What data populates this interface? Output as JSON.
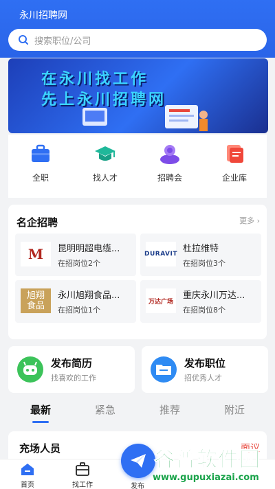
{
  "header": {
    "title": "永川招聘网"
  },
  "search": {
    "placeholder": "搜索职位/公司"
  },
  "banner": {
    "line1": "在永川找工作",
    "line2": "先上永川招聘网"
  },
  "quick_nav": [
    {
      "label": "全职",
      "icon": "briefcase-icon"
    },
    {
      "label": "找人才",
      "icon": "graduation-cap-icon"
    },
    {
      "label": "招聘会",
      "icon": "people-icon"
    },
    {
      "label": "企业库",
      "icon": "company-card-icon"
    }
  ],
  "famous": {
    "title": "名企招聘",
    "more": "更多",
    "companies": [
      {
        "name": "昆明明超电缆...",
        "count": "在招岗位2个",
        "logo_text": "M"
      },
      {
        "name": "杜拉维特",
        "count": "在招岗位3个",
        "logo_text": "DURAVIT"
      },
      {
        "name": "永川旭翔食品...",
        "count": "在招岗位1个",
        "logo_text": "旭翔食品"
      },
      {
        "name": "重庆永川万达...",
        "count": "在招岗位8个",
        "logo_text": "万达广场"
      }
    ]
  },
  "post_resume": {
    "title": "发布简历",
    "sub": "找喜欢的工作"
  },
  "post_job": {
    "title": "发布职位",
    "sub": "招优秀人才"
  },
  "tabs": [
    "最新",
    "紧急",
    "推荐",
    "附近"
  ],
  "job": {
    "title": "充场人员",
    "tag": "面议"
  },
  "bottom_nav": {
    "home": "首页",
    "find_job": "找工作",
    "publish": "发布"
  },
  "watermark": {
    "main": "谷普软件园",
    "url": "www.gupuxiazai.com"
  },
  "colors": {
    "primary": "#2f6ff3",
    "accent_red": "#e8473c",
    "watermark_green": "#1aa34a"
  }
}
